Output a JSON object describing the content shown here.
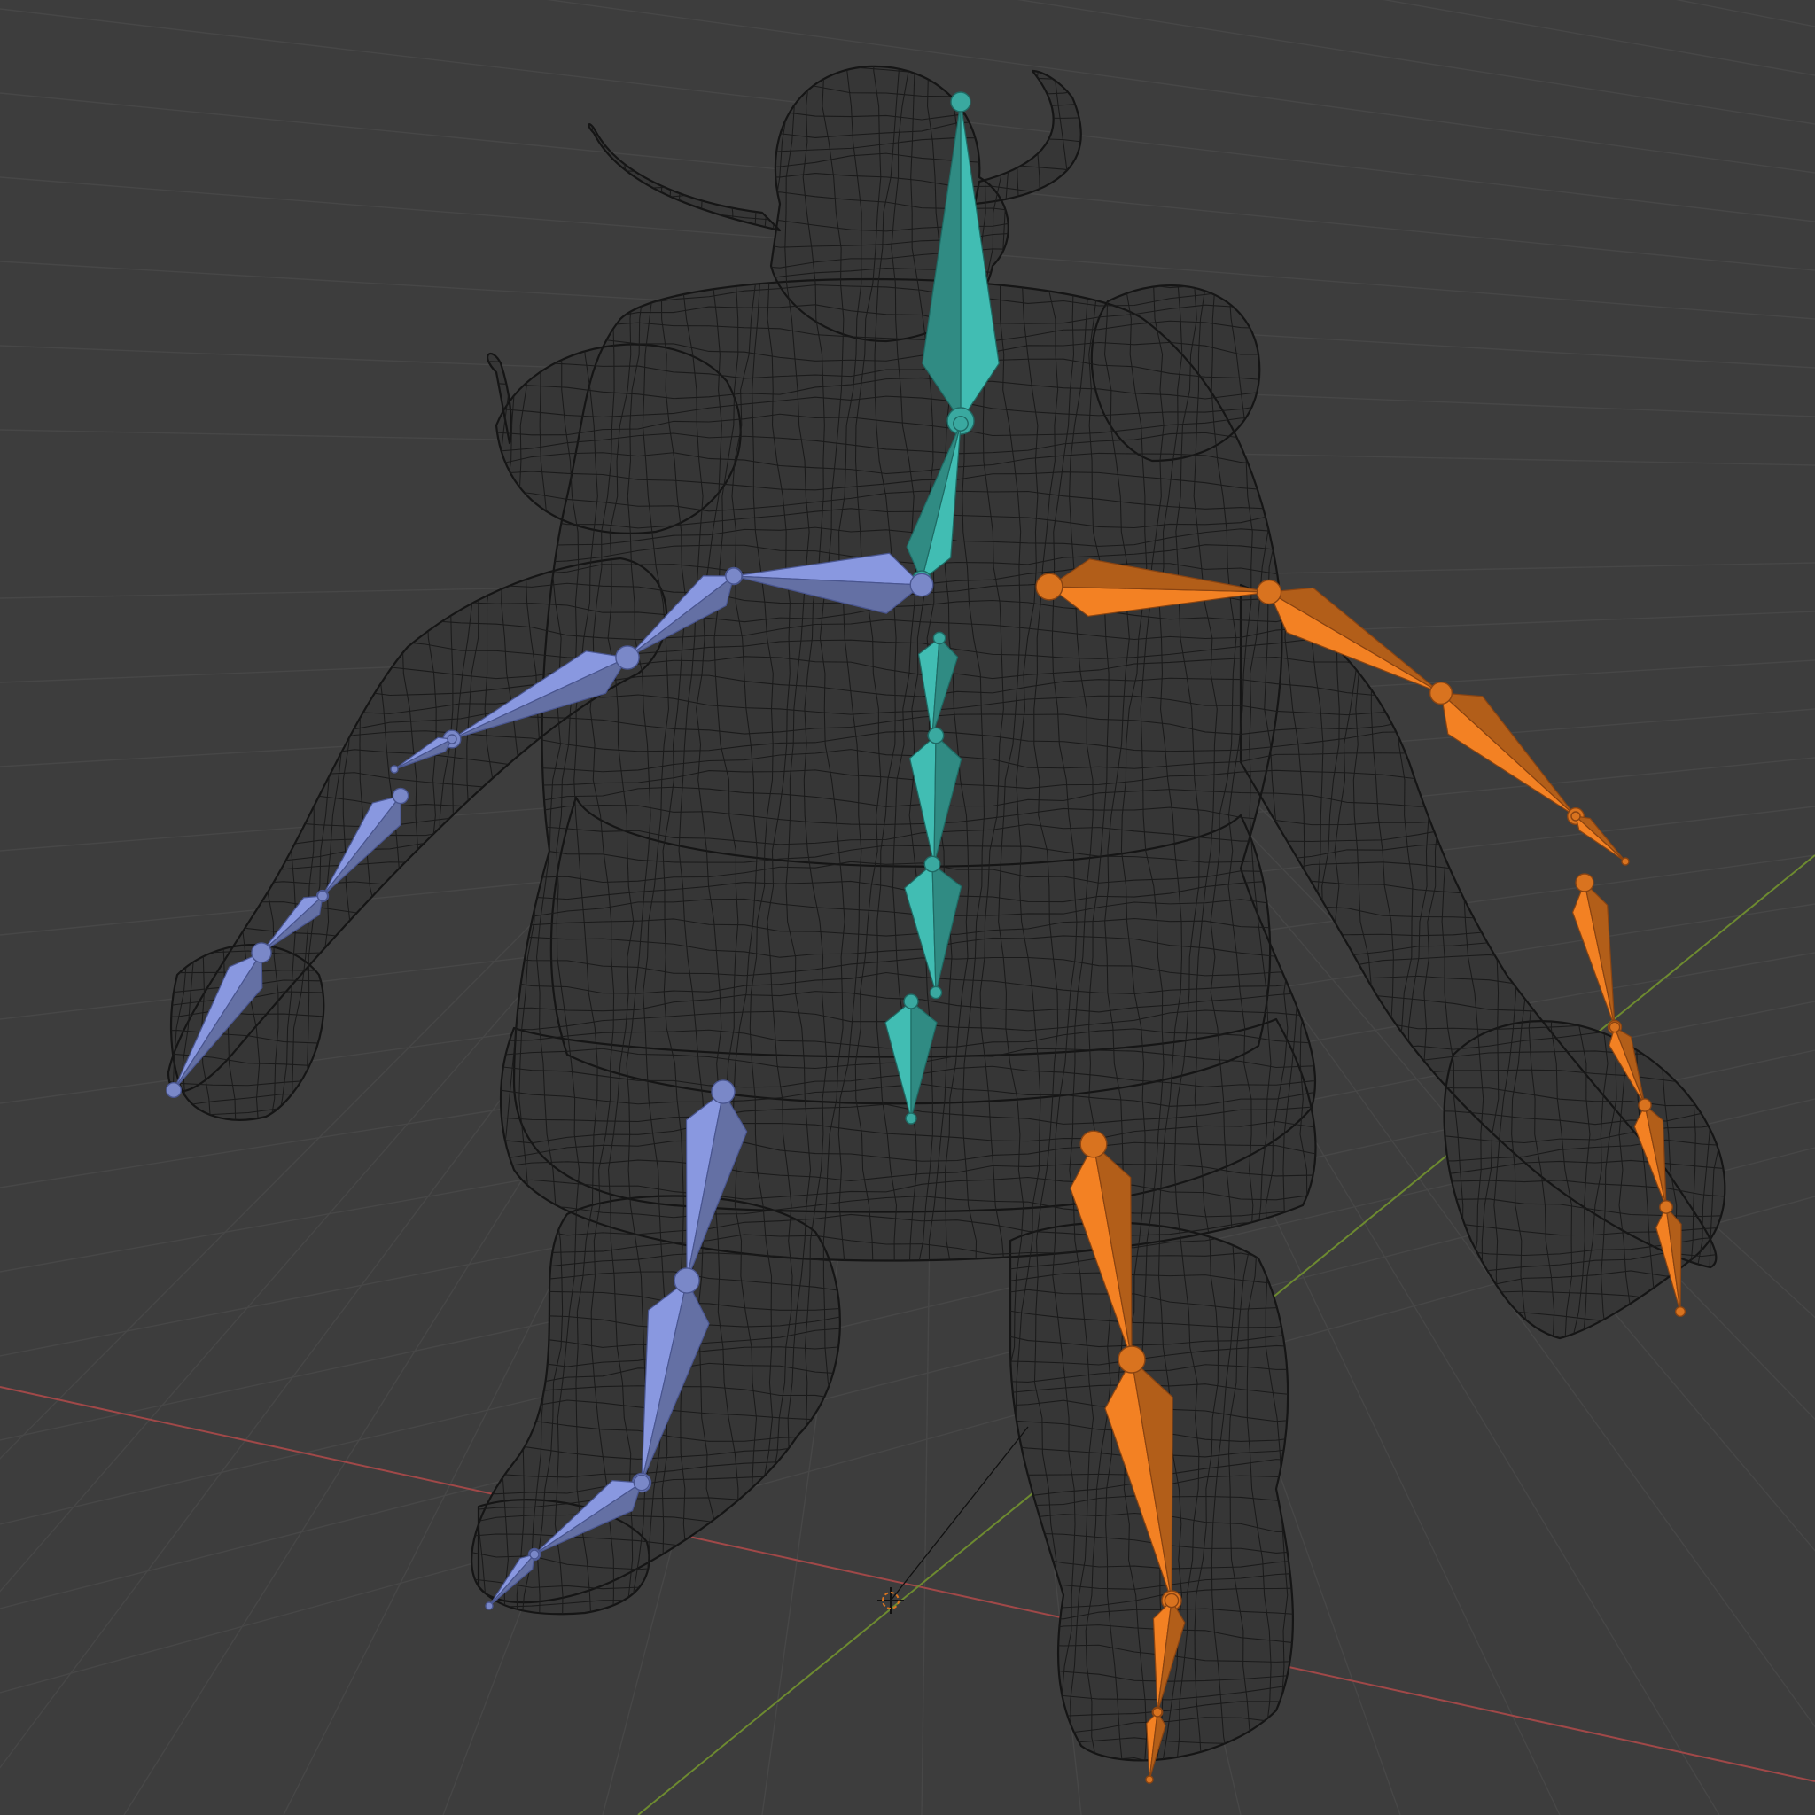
{
  "viewport": {
    "colors": {
      "background": "#3d3d3d",
      "grid": "#474747",
      "axis_x": "#a04848",
      "axis_y": "#6d8a30",
      "wireframe": "#1a1a1a"
    },
    "shading": "wireframe",
    "object": "minotaur-character-mesh",
    "armature": {
      "groups": [
        {
          "id": "center",
          "color": "#3aa9a0",
          "outline": "#1f6b65",
          "bones": [
            "head",
            "neck",
            "spine-upper",
            "spine-mid",
            "spine-lower",
            "hips"
          ]
        },
        {
          "id": "left",
          "color": "#7a88c8",
          "outline": "#4a5690",
          "bones": [
            "clavicle-left",
            "upper-arm-left",
            "forearm-left",
            "hand-left",
            "finger-left-1",
            "finger-left-2",
            "finger-left-3",
            "thigh-left",
            "shin-left",
            "foot-left",
            "toe-left"
          ]
        },
        {
          "id": "right",
          "color": "#d9731f",
          "outline": "#8a4412",
          "bones": [
            "clavicle-right",
            "upper-arm-right",
            "forearm-right",
            "hand-right",
            "finger-right-1",
            "finger-right-2",
            "finger-right-3",
            "finger-right-4",
            "thigh-right",
            "shin-right",
            "foot-right",
            "toe-right"
          ]
        }
      ]
    }
  }
}
